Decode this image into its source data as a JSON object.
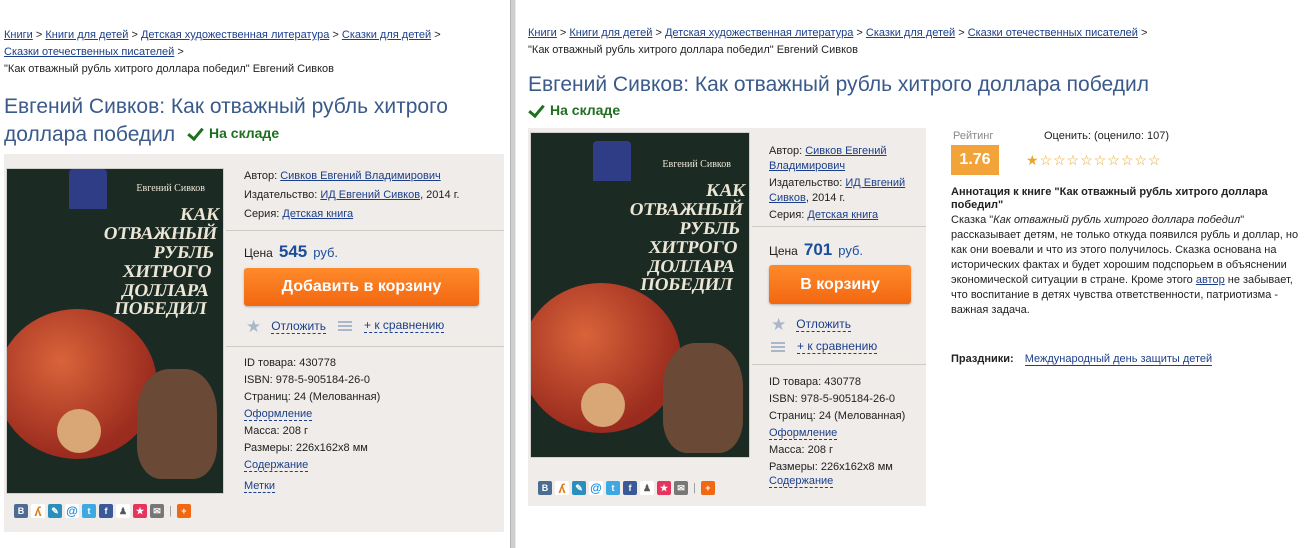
{
  "left": {
    "crumbs": [
      "Книги",
      "Книги для детей",
      "Детская художественная литература",
      "Сказки для детей",
      "Сказки отечественных писателей"
    ],
    "crumb_last": "\"Как отважный рубль хитрого доллара победил\" Евгений Сивков",
    "title_line1": "Евгений Сивков: Как отважный рубль хитрого",
    "title_line2": "доллара победил",
    "stock": "На складе",
    "cover_author": "Евгений Сивков",
    "cover_title": "КАК ОТВАЖНЫЙ РУБЛЬ ХИТРОГО ДОЛЛАРА ПОБЕДИЛ",
    "author_lbl": "Автор:",
    "author_val": "Сивков Евгений Владимирович",
    "publisher_lbl": "Издательство:",
    "publisher_val": "ИД Евгений Сивков",
    "publisher_year": ", 2014 г.",
    "series_lbl": "Серия:",
    "series_val": "Детская книга",
    "price_lbl": "Цена",
    "price_val": "545",
    "price_cur": "руб.",
    "cart_btn": "Добавить в корзину",
    "defer": "Отложить",
    "compare": "+ к сравнению",
    "id": "ID товара: 430778",
    "isbn": "ISBN: 978-5-905184-26-0",
    "pages": "Страниц: 24 (Мелованная)",
    "design": "Оформление",
    "mass": "Масса: 208 г",
    "size": "Размеры: 226x162x8 мм",
    "content": "Содержание",
    "tags": "Метки"
  },
  "right": {
    "crumbs": [
      "Книги",
      "Книги для детей",
      "Детская художественная литература",
      "Сказки для детей",
      "Сказки отечественных писателей"
    ],
    "crumb_last": "\"Как отважный рубль хитрого доллара победил\" Евгений Сивков",
    "title": "Евгений Сивков: Как отважный рубль хитрого доллара победил",
    "stock": "На складе",
    "cover_author": "Евгений Сивков",
    "cover_title": "КАК ОТВАЖНЫЙ РУБЛЬ ХИТРОГО ДОЛЛАРА ПОБЕДИЛ",
    "author_lbl": "Автор:",
    "author_val1": "Сивков Евгений",
    "author_val2": "Владимирович",
    "publisher_lbl": "Издательство:",
    "publisher_val1": "ИД Евгений",
    "publisher_val2": "Сивков",
    "publisher_year": ", 2014 г.",
    "series_lbl": "Серия:",
    "series_val": "Детская книга",
    "price_lbl": "Цена",
    "price_val": "701",
    "price_cur": "руб.",
    "cart_btn": "В корзину",
    "defer": "Отложить",
    "compare": "+ к сравнению",
    "id": "ID товара: 430778",
    "isbn": "ISBN: 978-5-905184-26-0",
    "pages": "Страниц: 24 (Мелованная)",
    "design": "Оформление",
    "mass": "Масса: 208 г",
    "size": "Размеры: 226x162x8 мм",
    "content": "Содержание",
    "rating_lbl": "Рейтинг",
    "rating_val": "1.76",
    "rate_lbl": "Оценить: (оценило: 107)",
    "stars": "★☆☆☆☆☆☆☆☆☆",
    "anno_title": "Аннотация к книге \"Как отважный рубль хитрого доллара победил\"",
    "anno_1": "Сказка \"",
    "anno_italic": "Как отважный рубль хитрого доллара победил",
    "anno_2": "\" рассказывает детям, не только откуда появился рубль и доллар, но как они воевали и что из этого получилось. Сказка основана на исторических фактах и будет хорошим подспорьем в объяснении экономической ситуации в стране. Кроме этого ",
    "anno_link": "автор",
    "anno_3": " не забывает, что воспитание в детях чувства ответственности, патриотизма - важная задача.",
    "holidays_lbl": "Праздники:",
    "holidays_val": "Международный день защиты детей"
  },
  "colors": {
    "accent": "#f26711",
    "link": "#1c3f8a",
    "title": "#3a5a8a",
    "stock": "#1f6f1f",
    "rating": "#f2a33a"
  }
}
